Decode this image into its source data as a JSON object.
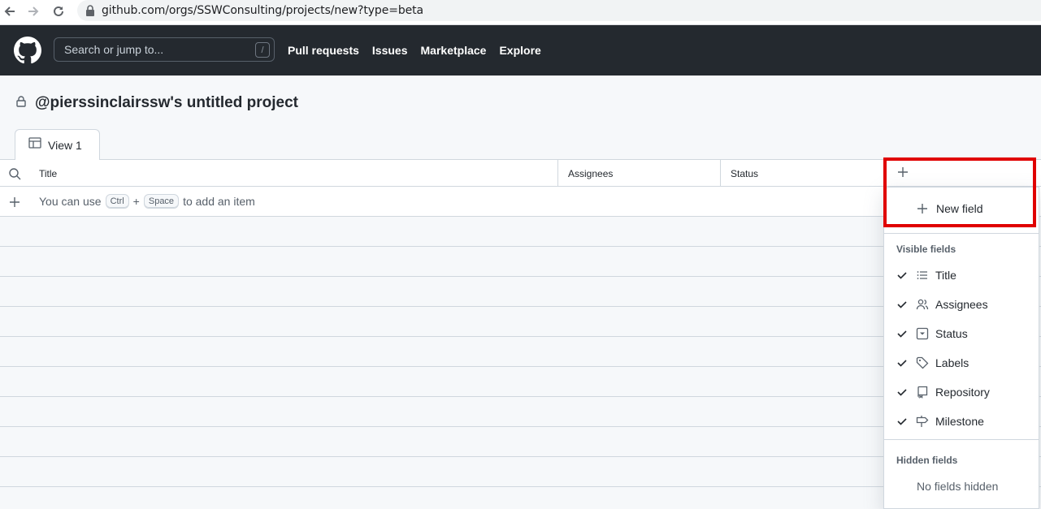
{
  "browser": {
    "url": "github.com/orgs/SSWConsulting/projects/new?type=beta"
  },
  "header": {
    "search_placeholder": "Search or jump to...",
    "search_shortcut": "/",
    "nav": [
      "Pull requests",
      "Issues",
      "Marketplace",
      "Explore"
    ]
  },
  "project": {
    "title": "@pierssinclairssw's untitled project",
    "tab_label": "View 1"
  },
  "table": {
    "columns": [
      "Title",
      "Assignees",
      "Status"
    ],
    "add_item": {
      "prefix": "You can use",
      "key1": "Ctrl",
      "plus": "+",
      "key2": "Space",
      "suffix": "to add an item"
    }
  },
  "field_menu": {
    "new_field_label": "New field",
    "visible_heading": "Visible fields",
    "visible_fields": [
      {
        "label": "Title",
        "icon": "list-icon"
      },
      {
        "label": "Assignees",
        "icon": "people-icon"
      },
      {
        "label": "Status",
        "icon": "single-select-icon"
      },
      {
        "label": "Labels",
        "icon": "tag-icon"
      },
      {
        "label": "Repository",
        "icon": "repo-icon"
      },
      {
        "label": "Milestone",
        "icon": "milestone-icon"
      }
    ],
    "hidden_heading": "Hidden fields",
    "hidden_empty": "No fields hidden"
  },
  "colors": {
    "header_bg": "#24292f",
    "highlight": "#e00000"
  }
}
